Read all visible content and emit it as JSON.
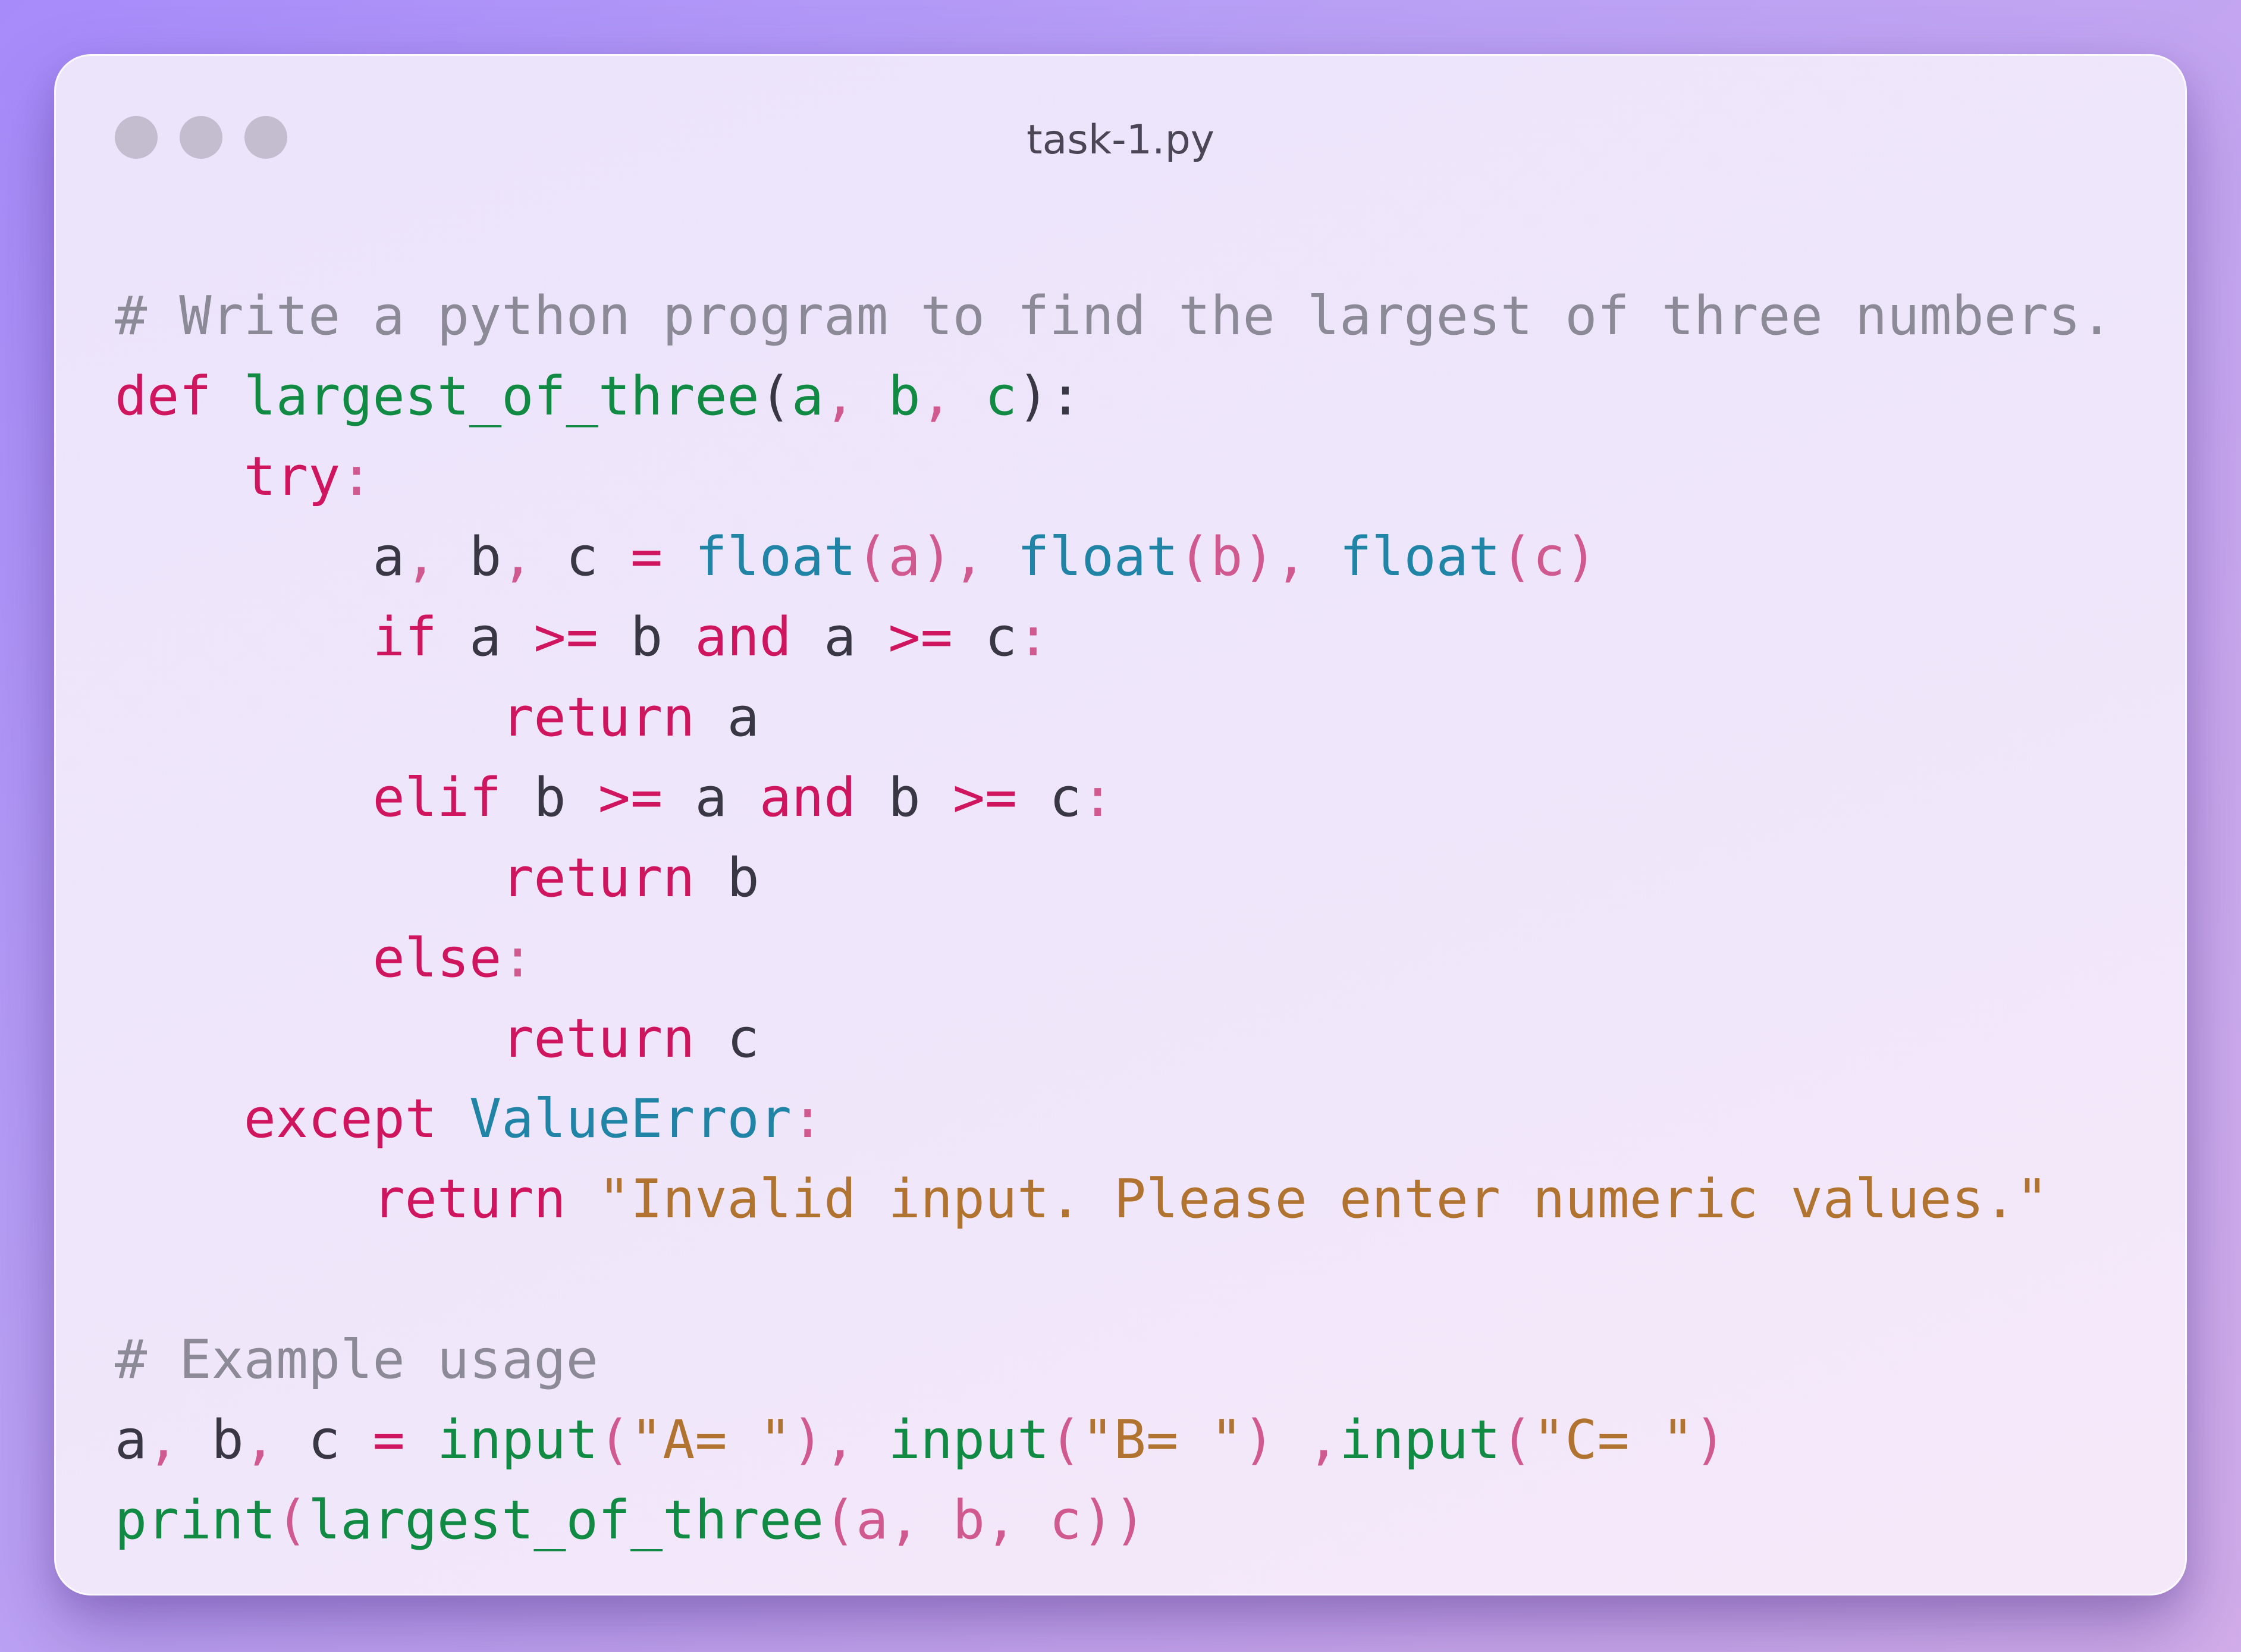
{
  "window": {
    "title": "task-1.py",
    "traffic_lights": [
      "close",
      "minimize",
      "zoom"
    ]
  },
  "colors": {
    "keyword": "#d0155f",
    "function": "#118b44",
    "builtin": "#1f84a6",
    "string": "#b07430",
    "comment": "#8d8a98",
    "punctuation": "#d05a8f",
    "text": "#3a3745"
  },
  "code": {
    "language": "python",
    "lines": [
      "# Write a python program to find the largest of three numbers.",
      "def largest_of_three(a, b, c):",
      "    try:",
      "        a, b, c = float(a), float(b), float(c)",
      "        if a >= b and a >= c:",
      "            return a",
      "        elif b >= a and b >= c:",
      "            return b",
      "        else:",
      "            return c",
      "    except ValueError:",
      "        return \"Invalid input. Please enter numeric values.\"",
      "",
      "# Example usage",
      "a, b, c = input(\"A= \"), input(\"B= \") ,input(\"C= \")",
      "print(largest_of_three(a, b, c))"
    ]
  }
}
